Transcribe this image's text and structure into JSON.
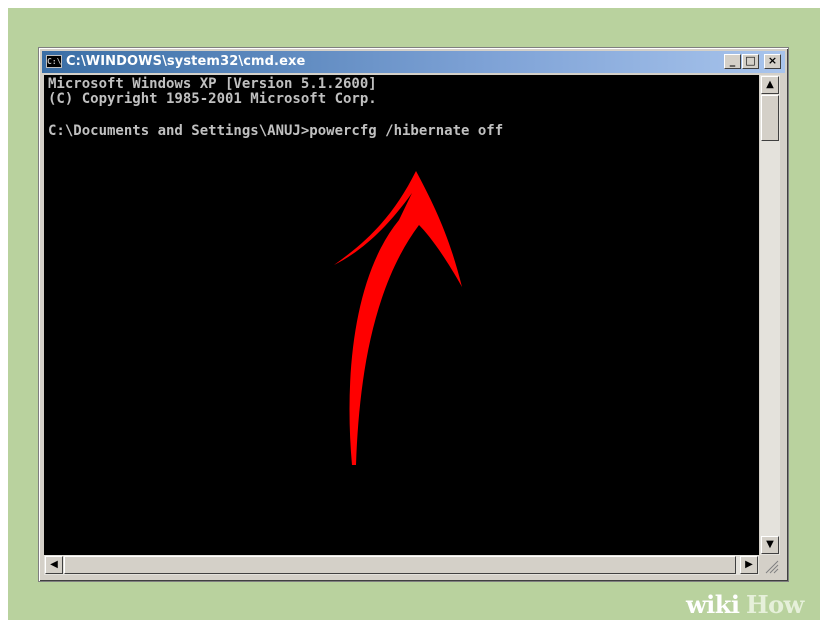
{
  "window": {
    "title": "C:\\WINDOWS\\system32\\cmd.exe",
    "icon": "cmd-icon",
    "buttons": {
      "minimize_label": "_",
      "maximize_label": "□",
      "close_label": "×"
    }
  },
  "console": {
    "lines": [
      "Microsoft Windows XP [Version 5.1.2600]",
      "(C) Copyright 1985-2001 Microsoft Corp.",
      "C:\\Documents and Settings\\ANUJ>powercfg /hibernate off"
    ]
  },
  "annotation": {
    "type": "arrow",
    "color": "#ff0000",
    "points_to": "powercfg /hibernate off"
  },
  "scrollbars": {
    "up_glyph": "▲",
    "down_glyph": "▼",
    "left_glyph": "◀",
    "right_glyph": "▶"
  },
  "watermark": {
    "wiki": "wiki",
    "how": "How"
  },
  "colors": {
    "background": "#b9d29e",
    "console_bg": "#000000",
    "console_text": "#c0c0c0",
    "title_bar": "#3a6ea5"
  }
}
